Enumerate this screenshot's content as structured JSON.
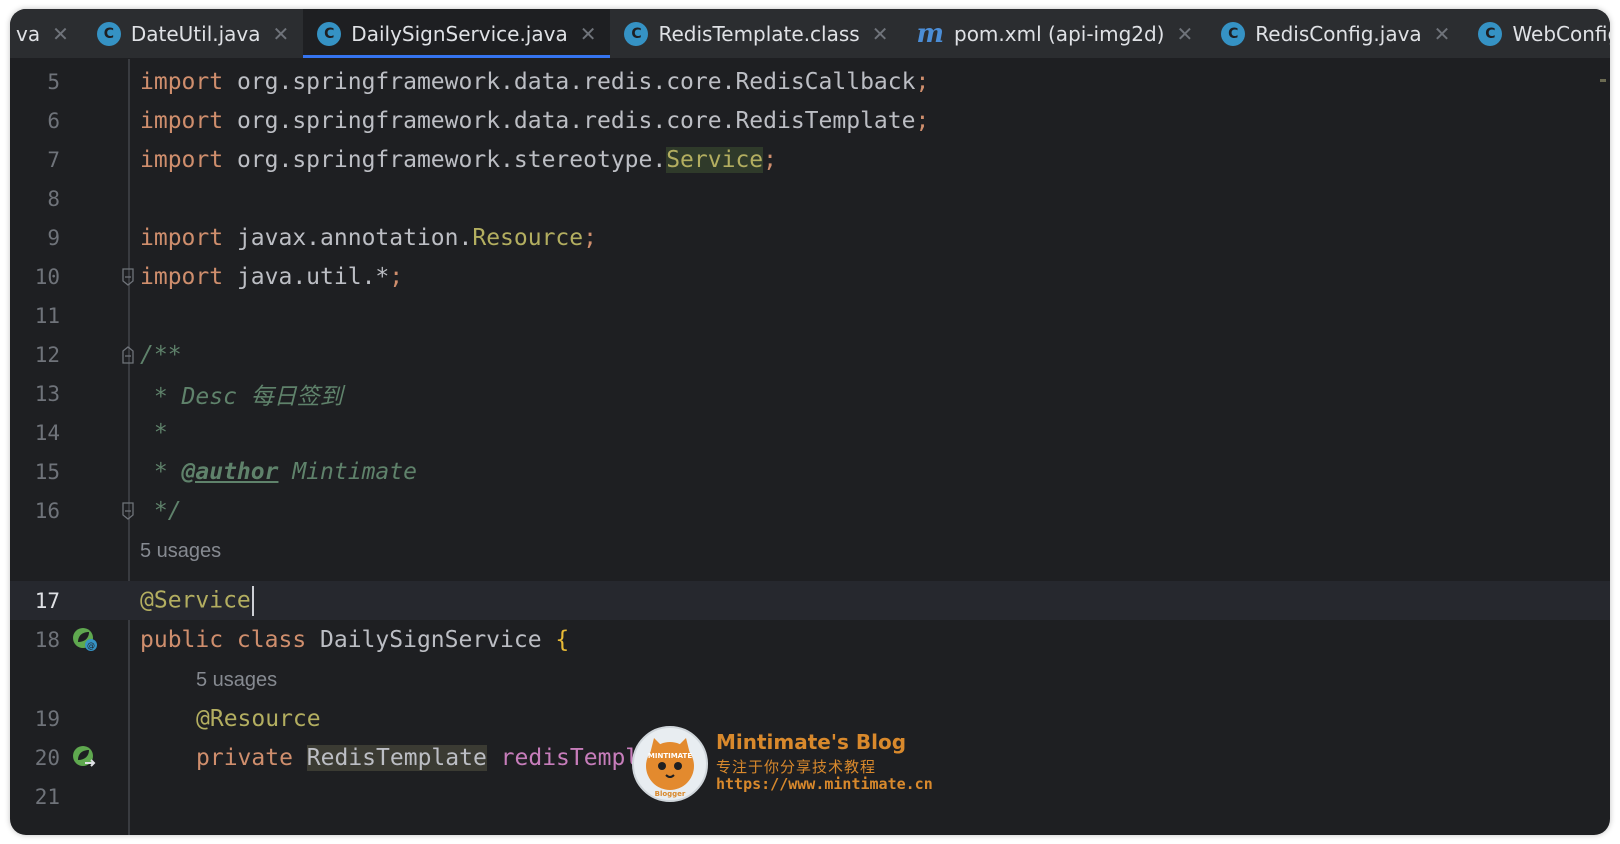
{
  "tabs": [
    {
      "label": "va",
      "icon": "none",
      "partial": true
    },
    {
      "label": "DateUtil.java",
      "icon": "java-class-icon"
    },
    {
      "label": "DailySignService.java",
      "icon": "java-class-icon",
      "active": true
    },
    {
      "label": "RedisTemplate.class",
      "icon": "java-class-icon"
    },
    {
      "label": "pom.xml (api-img2d)",
      "icon": "maven-icon"
    },
    {
      "label": "RedisConfig.java",
      "icon": "java-class-icon"
    },
    {
      "label": "WebConfig.java",
      "icon": "java-class-icon"
    }
  ],
  "editor": {
    "line_numbers": [
      "5",
      "6",
      "7",
      "8",
      "9",
      "10",
      "11",
      "12",
      "13",
      "14",
      "15",
      "16",
      "17",
      "18",
      "19",
      "20",
      "21"
    ],
    "current_line": "17",
    "code": {
      "l5_kw": "import",
      "l5_pkg": " org.springframework.data.redis.core.RedisCallback",
      "semi": ";",
      "l6_kw": "import",
      "l6_pkg": " org.springframework.data.redis.core.RedisTemplate",
      "l7_kw": "import",
      "l7_pkg": " org.springframework.stereotype.",
      "l7_cls": "Service",
      "l9_kw": "import",
      "l9_pkg": " javax.annotation.",
      "l9_cls": "Resource",
      "l10_kw": "import",
      "l10_pkg": " java.util.*",
      "l12": "/**",
      "l13": " * Desc 每日签到",
      "l14": " *",
      "l15_pre": " * ",
      "l15_tag": "@author",
      "l15_post": " Mintimate",
      "l16": " */",
      "l17": "@Service",
      "l18_kw": "public class",
      "l18_name": " DailySignService ",
      "l18_brace": "{",
      "l19": "@Resource",
      "l20_kw": "private",
      "l20_type": "RedisTemplate",
      "l20_field": "redisTemplate",
      "l20_semi": ";"
    },
    "usages_class": "5 usages",
    "usages_field": "5 usages"
  },
  "watermark": {
    "title": "Mintimate's Blog",
    "subtitle": "专注于你分享技术教程",
    "url": "https://www.mintimate.cn",
    "logo_text_top": "MINTIMATE",
    "logo_text_bottom": "Blogger"
  },
  "colors": {
    "background": "#1e1f22",
    "tabbar": "#2b2d30",
    "keyword": "#cf8e6d",
    "annotation": "#b3ae60",
    "comment": "#5f826b",
    "field": "#c77dbb",
    "active_tab_underline": "#3574f0"
  }
}
